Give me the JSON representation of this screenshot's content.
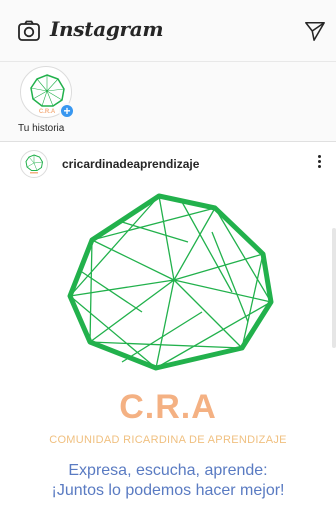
{
  "app": {
    "title": "Instagram"
  },
  "stories": [
    {
      "label": "Tu historia"
    }
  ],
  "post": {
    "username": "cricardinadeaprendizaje",
    "image": {
      "acronym": "C.R.A",
      "organization": "COMUNIDAD RICARDINA DE APRENDIZAJE",
      "tagline_line1": "Expresa, escucha, aprende:",
      "tagline_line2": "¡Juntos lo podemos hacer mejor!"
    }
  },
  "colors": {
    "logo_green": "#22b14c",
    "acronym": "#f4b183",
    "tagline": "#5a7bc2",
    "add_badge": "#3897f0"
  },
  "icons": [
    "camera-icon",
    "direct-send-icon",
    "add-story-icon",
    "more-options-icon"
  ]
}
